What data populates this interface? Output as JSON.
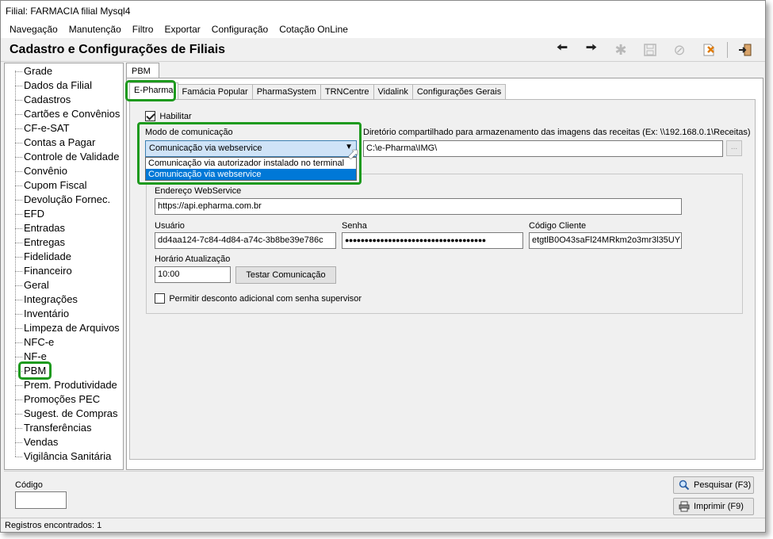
{
  "window_title": "Filial: FARMACIA filial Mysql4",
  "menu": [
    "Navegação",
    "Manutenção",
    "Filtro",
    "Exportar",
    "Configuração",
    "Cotação OnLine"
  ],
  "page_title": "Cadastro e Configurações de Filiais",
  "toolbar": {
    "icons": [
      "arrow-left-icon",
      "arrow-right-icon",
      "new-record-icon",
      "save-icon",
      "cancel-icon",
      "delete-icon",
      "exit-icon"
    ]
  },
  "tree": {
    "items": [
      "Grade",
      "Dados da Filial",
      "Cadastros",
      "Cartões e Convênios",
      "CF-e-SAT",
      "Contas a Pagar",
      "Controle de Validade",
      "Convênio",
      "Cupom Fiscal",
      "Devolução Fornec.",
      "EFD",
      "Entradas",
      "Entregas",
      "Fidelidade",
      "Financeiro",
      "Geral",
      "Integrações",
      "Inventário",
      "Limpeza de Arquivos",
      "NFC-e",
      "NF-e",
      "PBM",
      "Prem. Produtividade",
      "Promoções PEC",
      "Sugest. de Compras",
      "Transferências",
      "Vendas",
      "Vigilância Sanitária"
    ],
    "selected": "PBM"
  },
  "outer_tab": "PBM",
  "inner_tabs": [
    "E-Pharma",
    "Famácia Popular",
    "PharmaSystem",
    "TRNCentre",
    "Vidalink",
    "Configurações Gerais"
  ],
  "form": {
    "habilitar_label": "Habilitar",
    "habilitar_checked": true,
    "modo_label": "Modo de comunicação",
    "modo_value": "Comunicação via webservice",
    "modo_options": [
      "Comunicação via autorizador instalado no terminal",
      "Comunicação via webservice"
    ],
    "diretorio_label": "Diretório compartilhado para armazenamento das imagens das receitas (Ex: \\\\192.168.0.1\\Receitas)",
    "diretorio_value": "C:\\e-Pharma\\IMG\\",
    "browse_label": "...",
    "endereco_label": "Endereço WebService",
    "endereco_value": "https://api.epharma.com.br",
    "usuario_label": "Usuário",
    "usuario_value": "dd4aa124-7c84-4d84-a74c-3b8be39e786c",
    "senha_label": "Senha",
    "senha_value": "●●●●●●●●●●●●●●●●●●●●●●●●●●●●●●●●●●●●",
    "codigo_cliente_label": "Código Cliente",
    "codigo_cliente_value": "etgtlB0O43saFl24MRkm2o3mr3l35UY",
    "horario_label": "Horário Atualização",
    "horario_value": "10:00",
    "testar_label": "Testar Comunicação",
    "desconto_label": "Permitir desconto adicional com senha supervisor",
    "desconto_checked": false
  },
  "bottom": {
    "codigo_label": "Código",
    "codigo_value": "",
    "pesquisar_label": "Pesquisar (F3)",
    "imprimir_label": "Imprimir (F9)"
  },
  "status": "Registros encontrados: 1",
  "colors": {
    "highlight": "#1e9a1e",
    "selection": "#0078d7"
  }
}
